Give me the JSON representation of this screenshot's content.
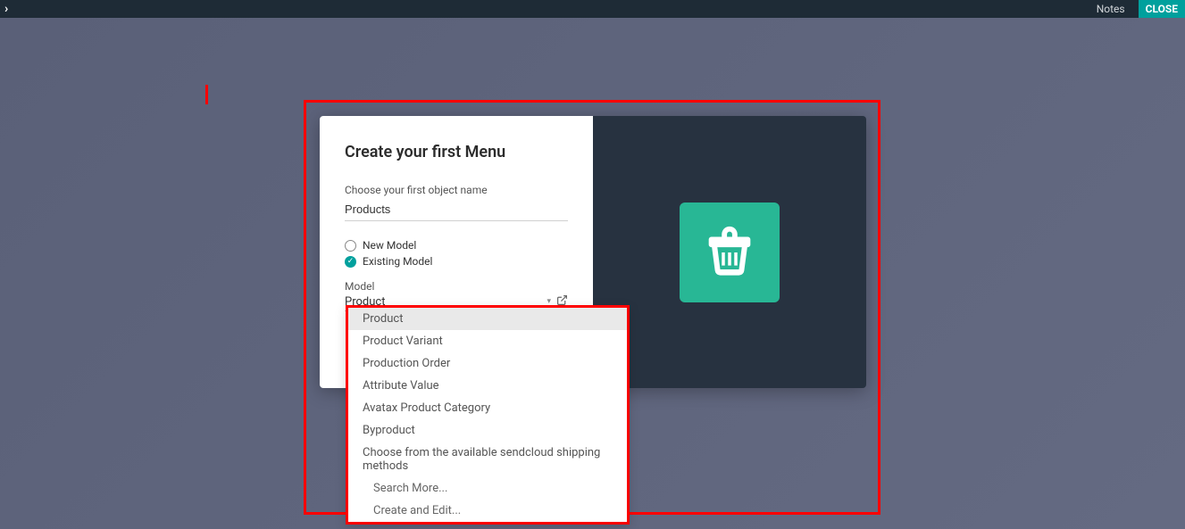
{
  "topbar": {
    "notes_label": "Notes",
    "close_label": "CLOSE"
  },
  "modal": {
    "title": "Create your first Menu",
    "choose_label": "Choose your first object name",
    "object_name_value": "Products",
    "radio_new": "New Model",
    "radio_existing": "Existing Model",
    "model_label": "Model",
    "model_value": "Product"
  },
  "dropdown": {
    "items": [
      "Product",
      "Product Variant",
      "Production Order",
      "Attribute Value",
      "Avatax Product Category",
      "Byproduct",
      "Choose from the available sendcloud shipping methods"
    ],
    "search_more": "Search More...",
    "create_edit": "Create and Edit..."
  },
  "icons": {
    "basket_color": "#28b795"
  }
}
